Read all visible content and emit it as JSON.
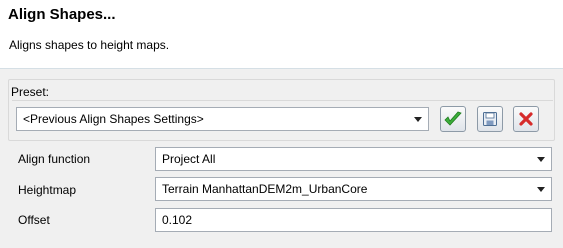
{
  "dialog": {
    "title": "Align Shapes...",
    "description": "Aligns shapes to height maps."
  },
  "preset": {
    "label": "Preset:",
    "selected": "<Previous Align Shapes Settings>",
    "icons": {
      "apply": "checkmark-icon",
      "save": "floppy-disk-icon",
      "delete": "red-x-icon"
    },
    "colors": {
      "apply": "#3cae3c",
      "delete": "#d62b2b"
    }
  },
  "fields": {
    "align_function": {
      "label": "Align function",
      "value": "Project All"
    },
    "heightmap": {
      "label": "Heightmap",
      "value": "Terrain ManhattanDEM2m_UrbanCore"
    },
    "offset": {
      "label": "Offset",
      "value": "0.102"
    }
  }
}
